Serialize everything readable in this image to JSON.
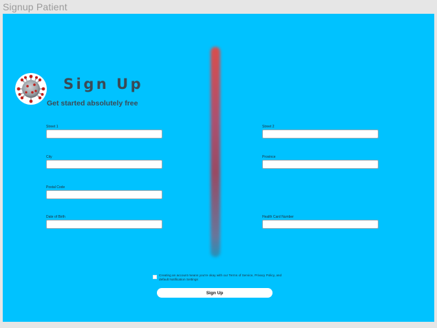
{
  "window": {
    "title": "Signup Patient"
  },
  "header": {
    "title": "Sign Up",
    "subtitle": "Get started absolutely free",
    "logo_icon": "virus-icon"
  },
  "form": {
    "left_fields": [
      {
        "label": "Street 1",
        "value": ""
      },
      {
        "label": "City",
        "value": ""
      },
      {
        "label": "Postal Code",
        "value": ""
      },
      {
        "label": "Date of Birth",
        "value": ""
      }
    ],
    "right_fields": [
      {
        "label": "Street 2",
        "value": ""
      },
      {
        "label": "Province",
        "value": ""
      },
      {
        "label": "Health Card Number",
        "value": ""
      }
    ],
    "terms_text": "Creating an account means you're okay with our Terms of Service, Privacy Policy, and default Notification Settings",
    "submit_label": "Sign Up"
  },
  "colors": {
    "panel_background": "#00c2ff",
    "window_background": "#e6e6e6",
    "title_text": "#3b4a55",
    "divider_top": "#ff3a2e",
    "divider_bottom": "#2a8ab0",
    "button_background": "#ffffff"
  }
}
